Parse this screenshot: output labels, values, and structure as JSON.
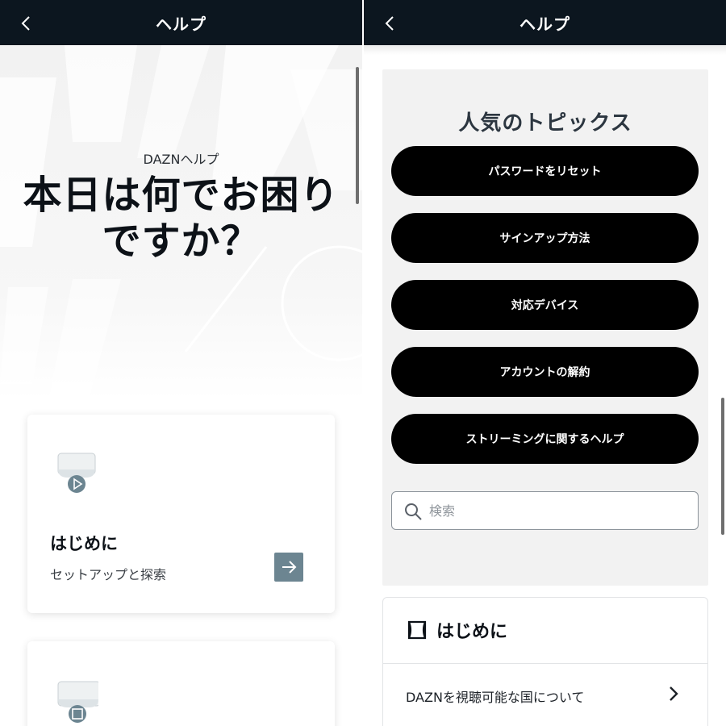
{
  "left_screen": {
    "header": {
      "title": "ヘルプ",
      "back_icon": "chevron-left-icon"
    },
    "hero": {
      "subtitle": "DAZNヘルプ",
      "title": "本日は何でお困りですか？"
    },
    "cards": [
      {
        "icon": "play-device-icon",
        "title": "はじめに",
        "description": "セットアップと探索",
        "action_icon": "arrow-right-icon"
      },
      {
        "icon": "square-device-icon"
      }
    ]
  },
  "right_screen": {
    "header": {
      "title": "ヘルプ",
      "back_icon": "chevron-left-icon"
    },
    "popular_topics": {
      "title": "人気のトピックス",
      "items": [
        "パスワードをリセット",
        "サインアップ方法",
        "対応デバイス",
        "アカウントの解約",
        "ストリーミングに関するヘルプ"
      ]
    },
    "search": {
      "placeholder": "検索",
      "value": "",
      "icon": "search-icon"
    },
    "section": {
      "icon": "ticket-icon",
      "title": "はじめに",
      "links": [
        {
          "label": "DAZNを視聴可能な国について",
          "icon": "chevron-right-icon"
        }
      ]
    }
  },
  "colors": {
    "header_bg": "#0c161f",
    "pill_bg": "#000000",
    "accent_arrow": "#6c8591",
    "panel_bg": "#f2f2f2"
  }
}
